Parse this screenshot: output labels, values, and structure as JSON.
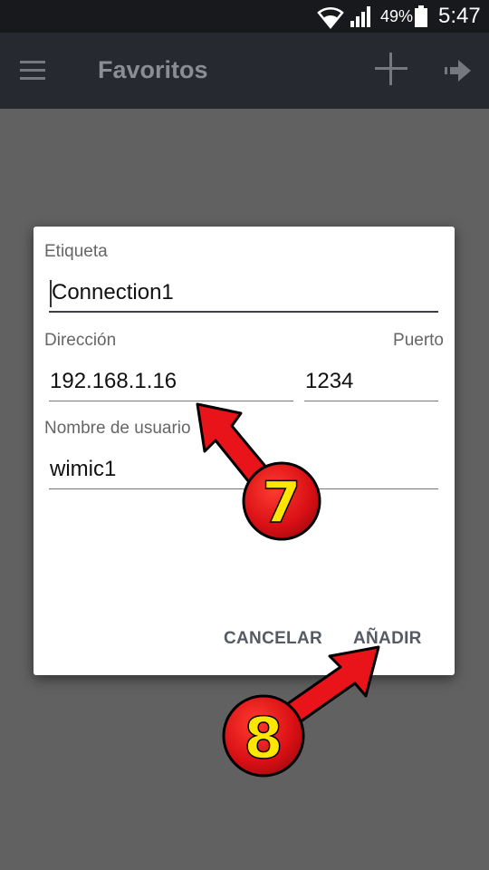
{
  "status_bar": {
    "battery_percent": "49%",
    "time": "5:47",
    "icons": [
      "wifi-icon",
      "signal-icon",
      "battery-icon"
    ]
  },
  "toolbar": {
    "title": "Favoritos",
    "icons": [
      "menu-icon",
      "add-icon",
      "forward-icon"
    ]
  },
  "dialog": {
    "label_field": {
      "label": "Etiqueta",
      "value": "Connection1"
    },
    "address_field": {
      "label": "Dirección",
      "value": "192.168.1.16"
    },
    "port_field": {
      "label": "Puerto",
      "value": "1234"
    },
    "username_field": {
      "label": "Nombre de usuario",
      "value": "wimic1"
    },
    "cancel_label": "CANCELAR",
    "add_label": "AÑADIR"
  },
  "annotations": {
    "step_7": "7",
    "step_8": "8"
  },
  "colors": {
    "backdrop": "#616161",
    "toolbar": "#262a30",
    "status_bar": "#17191d",
    "arrow_red": "#e8141a",
    "badge_yellow": "#ffe600"
  }
}
